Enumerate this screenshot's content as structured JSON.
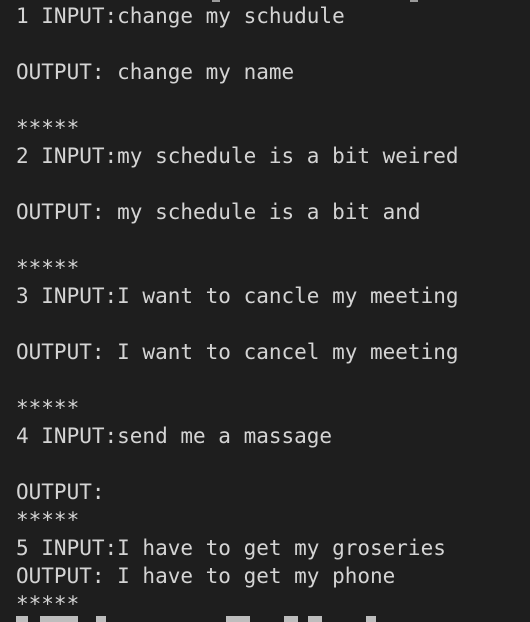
{
  "terminal": {
    "lines": [
      "1 INPUT:change my schudule",
      "OUTPUT: change my name",
      "*****",
      "2 INPUT:my schedule is a bit weired",
      "OUTPUT: my schedule is a bit and",
      "*****",
      "3 INPUT:I want to cancle my meeting",
      "OUTPUT: I want to cancel my meeting",
      "*****",
      "4 INPUT:send me a massage",
      "OUTPUT:",
      "*****",
      "5 INPUT:I have to get my groseries",
      "OUTPUT: I have to get my phone",
      "*****"
    ]
  }
}
